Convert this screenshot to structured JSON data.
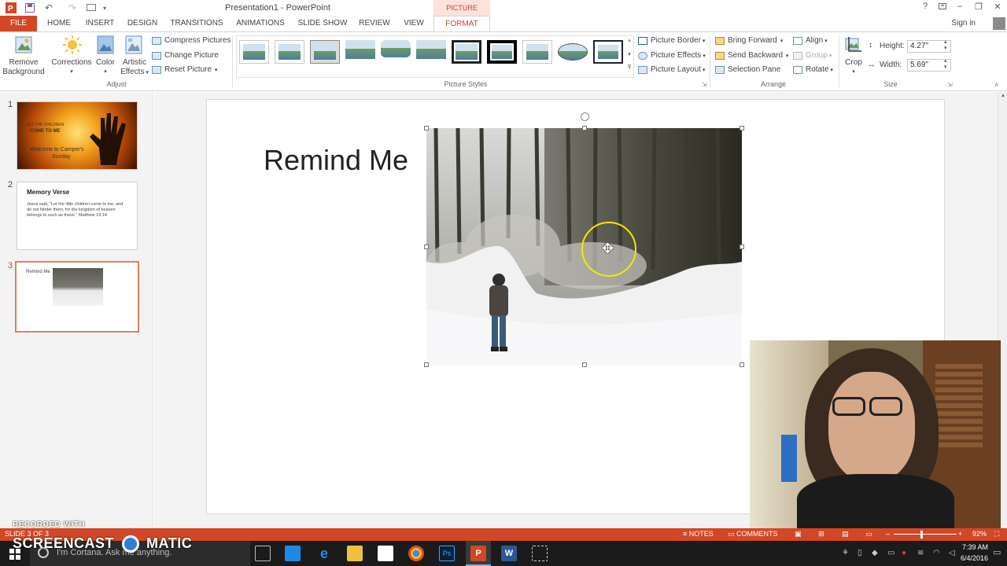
{
  "app": {
    "title": "Presentation1 - PowerPoint",
    "contextual_tab_group": "PICTURE TOOLS",
    "help": "?",
    "sign_in": "Sign in"
  },
  "tabs": [
    {
      "label": "FILE"
    },
    {
      "label": "HOME"
    },
    {
      "label": "INSERT"
    },
    {
      "label": "DESIGN"
    },
    {
      "label": "TRANSITIONS"
    },
    {
      "label": "ANIMATIONS"
    },
    {
      "label": "SLIDE SHOW"
    },
    {
      "label": "REVIEW"
    },
    {
      "label": "VIEW"
    },
    {
      "label": "FORMAT"
    }
  ],
  "ribbon": {
    "adjust": {
      "group_label": "Adjust",
      "remove_background_1": "Remove",
      "remove_background_2": "Background",
      "corrections": "Corrections",
      "color": "Color",
      "artistic_1": "Artistic",
      "artistic_2": "Effects",
      "compress": "Compress Pictures",
      "change": "Change Picture",
      "reset": "Reset Picture"
    },
    "picture_styles": {
      "group_label": "Picture Styles",
      "border": "Picture Border",
      "effects": "Picture Effects",
      "layout": "Picture Layout"
    },
    "arrange": {
      "group_label": "Arrange",
      "bring_forward": "Bring Forward",
      "send_backward": "Send Backward",
      "selection_pane": "Selection Pane",
      "align": "Align",
      "group": "Group",
      "rotate": "Rotate"
    },
    "size": {
      "group_label": "Size",
      "crop": "Crop",
      "height_label": "Height:",
      "height_value": "4.27\"",
      "width_label": "Width:",
      "width_value": "5.69\""
    }
  },
  "slides": [
    {
      "number": "1",
      "line1": "LET THE CHILDREN",
      "line2": "COME TO ME",
      "line3": "Welcome to Camper's",
      "line4": "Sunday"
    },
    {
      "number": "2",
      "title": "Memory Verse",
      "body": "Jesus said, \"Let the little children come to me, and do not hinder them, for the kingdom of heaven belongs to such as these.\"   Matthew 19:14"
    },
    {
      "number": "3",
      "title": "Remind Me"
    }
  ],
  "current_slide": {
    "title": "Remind Me"
  },
  "status": {
    "slide_counter": "SLIDE 3 OF 3",
    "notes": "NOTES",
    "comments": "COMMENTS",
    "zoom": "92%"
  },
  "taskbar": {
    "cortana": "I'm Cortana. Ask me anything.",
    "time": "7:39 AM",
    "date": "6/4/2016"
  },
  "watermark": {
    "small": "RECORDED WITH",
    "big_left": "SCREENCAST",
    "big_right": "MATIC"
  },
  "colors": {
    "accent": "#d24726",
    "context_tab": "#c5452b",
    "cursor_ring": "#f5e800"
  }
}
